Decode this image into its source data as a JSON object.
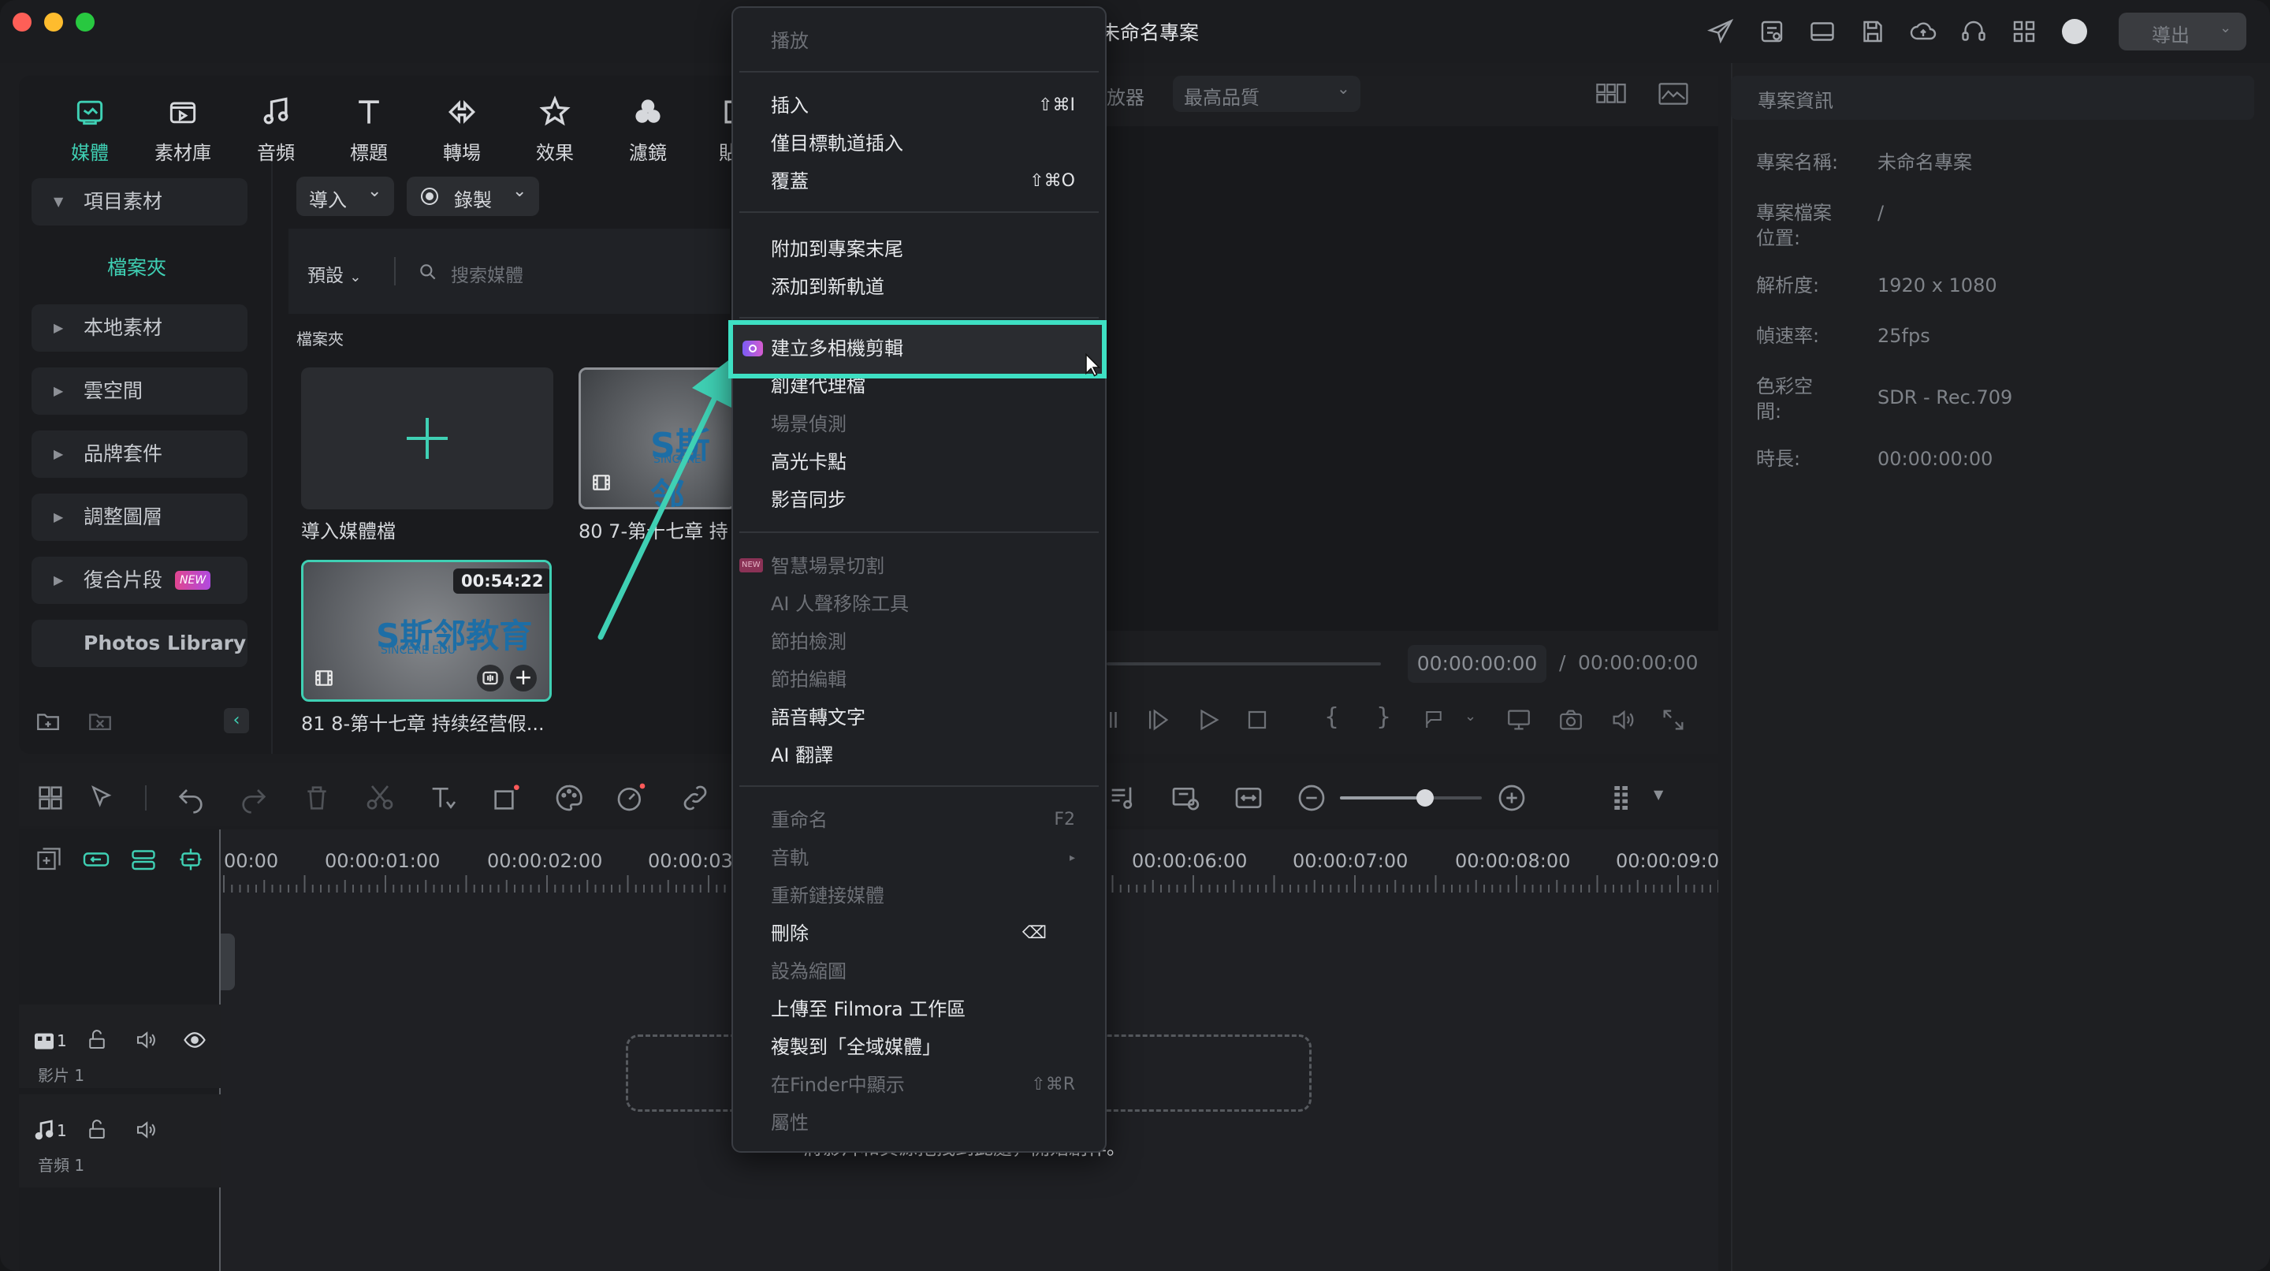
{
  "window": {
    "title": "未命名專案",
    "export_label": "導出"
  },
  "tabs": [
    {
      "label": "媒體",
      "icon": "media-icon",
      "active": true
    },
    {
      "label": "素材庫",
      "icon": "stock-icon"
    },
    {
      "label": "音頻",
      "icon": "music-note-icon"
    },
    {
      "label": "標題",
      "icon": "title-t-icon"
    },
    {
      "label": "轉場",
      "icon": "transition-icon"
    },
    {
      "label": "效果",
      "icon": "effects-star-icon"
    },
    {
      "label": "濾鏡",
      "icon": "filters-icon"
    },
    {
      "label": "貼",
      "icon": "sticker-icon"
    }
  ],
  "sidebar": {
    "items": [
      {
        "label": "項目素材",
        "expanded": true
      },
      {
        "label": "檔案夾",
        "active": true
      },
      {
        "label": "本地素材"
      },
      {
        "label": "雲空間"
      },
      {
        "label": "品牌套件"
      },
      {
        "label": "調整圖層"
      },
      {
        "label": "復合片段",
        "badge": "NEW"
      },
      {
        "label": "Photos Library"
      }
    ]
  },
  "media_toolbar": {
    "import_label": "導入",
    "record_label": "錄製",
    "preset_label": "預設",
    "search_placeholder": "搜索媒體",
    "folder_label": "檔案夾"
  },
  "media_items": [
    {
      "label": "導入媒體檔"
    },
    {
      "label": "80 7-第十七章 持",
      "logo_text": "S斯邻",
      "logo_sub": "SINCERE"
    },
    {
      "label": "81 8-第十七章 持续经营假...",
      "duration": "00:54:22",
      "logo_text": "S斯邻教育",
      "logo_sub": "SINCERE EDU"
    }
  ],
  "preview": {
    "player_label": "放器",
    "quality_label": "最高品質",
    "current_time": "00:00:00:00",
    "separator": "/",
    "total_time": "00:00:00:00"
  },
  "project_info": {
    "title": "專案資訊",
    "rows": [
      {
        "label": "專案名稱:",
        "value": "未命名專案"
      },
      {
        "label": "專案檔案\n位置:",
        "value": "/"
      },
      {
        "label": "解析度:",
        "value": "1920 x 1080"
      },
      {
        "label": "幀速率:",
        "value": "25fps"
      },
      {
        "label": "色彩空\n間:",
        "value": "SDR - Rec.709"
      },
      {
        "label": "時長:",
        "value": "00:00:00:00"
      }
    ]
  },
  "timeline": {
    "ruler": [
      "00:00",
      "00:00:01:00",
      "00:00:02:00",
      "00:00:03",
      "00:00:06:00",
      "00:00:07:00",
      "00:00:08:00",
      "00:00:09:0"
    ],
    "zoom_level": 0.6,
    "tracks": [
      {
        "name": "影片 1",
        "index": "1"
      },
      {
        "name": "音頻 1",
        "index": "1"
      }
    ],
    "drop_hint": "將影片和資源拖拽到此處，開始創作。"
  },
  "context_menu": {
    "groups": [
      [
        {
          "label": "播放",
          "disabled": true
        }
      ],
      [
        {
          "label": "插入",
          "shortcut": "⇧⌘I"
        },
        {
          "label": "僅目標軌道插入"
        },
        {
          "label": "覆蓋",
          "shortcut": "⇧⌘O"
        }
      ],
      [
        {
          "label": "附加到專案末尾"
        },
        {
          "label": "添加到新軌道"
        }
      ],
      [
        {
          "label": "建立多相機剪輯",
          "highlighted": true,
          "icon": "multicam-icon"
        },
        {
          "label": "創建代理檔"
        },
        {
          "label": "場景偵測",
          "disabled": true
        },
        {
          "label": "高光卡點"
        },
        {
          "label": "影音同步"
        }
      ],
      [
        {
          "label": "智慧場景切割",
          "disabled": true,
          "badge": "NEW"
        },
        {
          "label": "AI 人聲移除工具",
          "disabled": true
        },
        {
          "label": "節拍檢測",
          "disabled": true
        },
        {
          "label": "節拍編輯",
          "disabled": true
        },
        {
          "label": "語音轉文字"
        },
        {
          "label": "AI 翻譯"
        }
      ],
      [
        {
          "label": "重命名",
          "shortcut": "F2",
          "disabled": true
        },
        {
          "label": "音軌",
          "disabled": true,
          "submenu": true
        },
        {
          "label": "重新鏈接媒體",
          "disabled": true
        },
        {
          "label": "刪除",
          "shortcut": "⌫"
        },
        {
          "label": "設為縮圖",
          "disabled": true
        },
        {
          "label": "上傳至 Filmora 工作區"
        },
        {
          "label": "複製到「全域媒體」"
        },
        {
          "label": "在Finder中顯示",
          "shortcut": "⇧⌘R",
          "disabled": true
        },
        {
          "label": "屬性",
          "disabled": true
        }
      ]
    ]
  },
  "colors": {
    "accent": "#3fd0b4",
    "highlight_box": "#3ee0c3",
    "new_badge": "#e0468f"
  }
}
